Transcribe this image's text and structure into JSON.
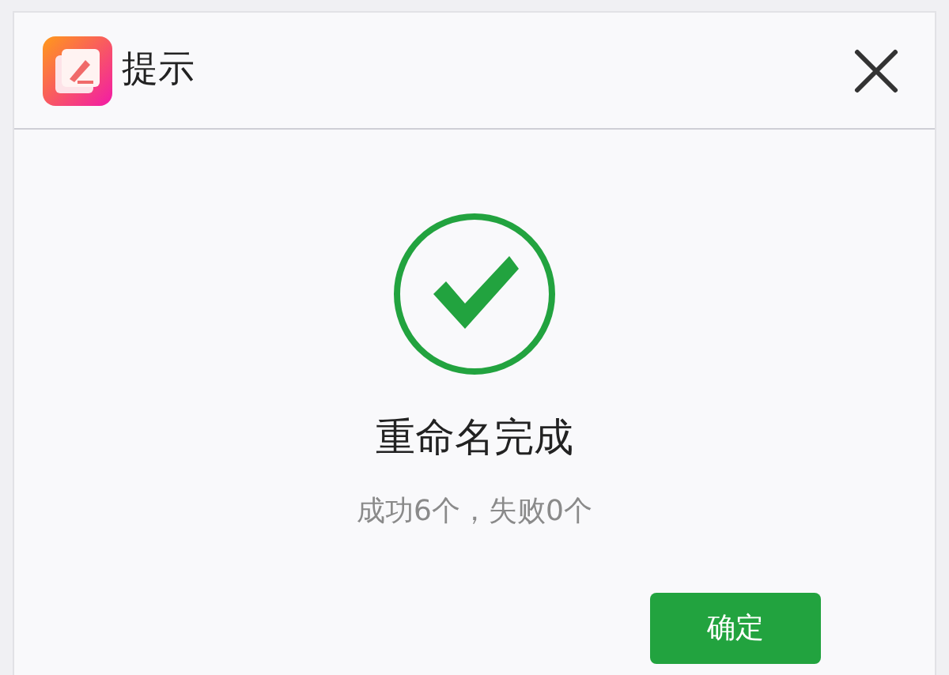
{
  "window": {
    "title": "提示"
  },
  "message": {
    "title": "重命名完成",
    "detail": "成功6个，失败0个"
  },
  "buttons": [
    {
      "label": "确定"
    }
  ]
}
